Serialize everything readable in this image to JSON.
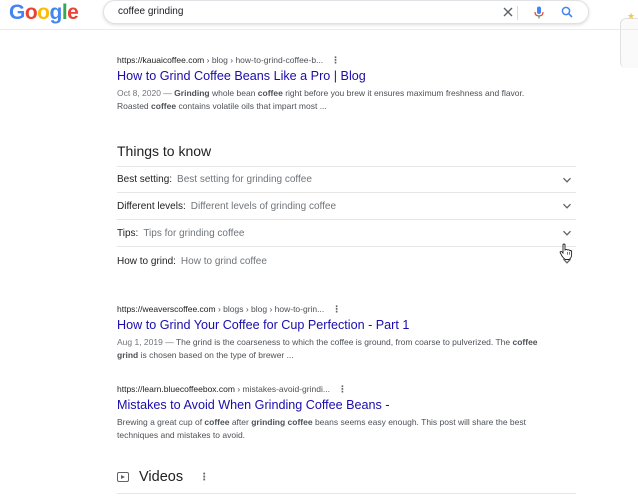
{
  "header": {
    "logo": {
      "letters": [
        "G",
        "o",
        "o",
        "g",
        "l",
        "e"
      ],
      "colors": [
        "#4285f4",
        "#ea4335",
        "#fbbc05",
        "#4285f4",
        "#34a853",
        "#ea4335"
      ]
    },
    "search": {
      "query": "coffee grinding",
      "icons": [
        "close-icon",
        "microphone-icon",
        "search-icon"
      ]
    }
  },
  "results": [
    {
      "domain": "https://kauaicoffee.com",
      "path": " › blog › how-to-grind-coffee-b...",
      "title": "How to Grind Coffee Beans Like a Pro | Blog",
      "date": "Oct 8, 2020 — ",
      "snippet_parts": [
        {
          "t": ""
        },
        {
          "b": "Grinding"
        },
        {
          "t": " whole bean "
        },
        {
          "b": "coffee"
        },
        {
          "t": " right before you brew it ensures maximum freshness and flavor. Roasted "
        },
        {
          "b": "coffee"
        },
        {
          "t": " contains volatile oils that impart most ..."
        }
      ]
    },
    {
      "domain": "https://weaverscoffee.com",
      "path": " › blogs › blog › how-to-grin...",
      "title": "How to Grind Your Coffee for Cup Perfection - Part 1",
      "date": "Aug 1, 2019 — ",
      "snippet_parts": [
        {
          "t": "The grind is the coarseness to which the coffee is ground, from coarse to pulverized. The "
        },
        {
          "b": "coffee grind"
        },
        {
          "t": " is chosen based on the type of brewer ..."
        }
      ]
    },
    {
      "domain": "https://learn.bluecoffeebox.com",
      "path": " › mistakes-avoid-grindi...",
      "title": "Mistakes to Avoid When Grinding Coffee Beans -",
      "date": "",
      "snippet_parts": [
        {
          "t": "Brewing a great cup of "
        },
        {
          "b": "coffee"
        },
        {
          "t": " after "
        },
        {
          "b": "grinding coffee"
        },
        {
          "t": " beans seems easy enough. This post will share the best techniques and mistakes to avoid."
        }
      ]
    }
  ],
  "things_to_know": {
    "title": "Things to know",
    "items": [
      {
        "key": "Best setting:",
        "value": "Best setting for grinding coffee"
      },
      {
        "key": "Different levels:",
        "value": "Different levels of grinding coffee"
      },
      {
        "key": "Tips:",
        "value": "Tips for grinding coffee"
      },
      {
        "key": "How to grind:",
        "value": "How to grind coffee"
      }
    ]
  },
  "videos": {
    "label": "Videos",
    "more": "⋮"
  },
  "colors": {
    "link": "#1a0dab",
    "snippet": "#4d5156",
    "secondary": "#70757a",
    "mic": "#4285f4",
    "search_icon": "#4285f4"
  }
}
